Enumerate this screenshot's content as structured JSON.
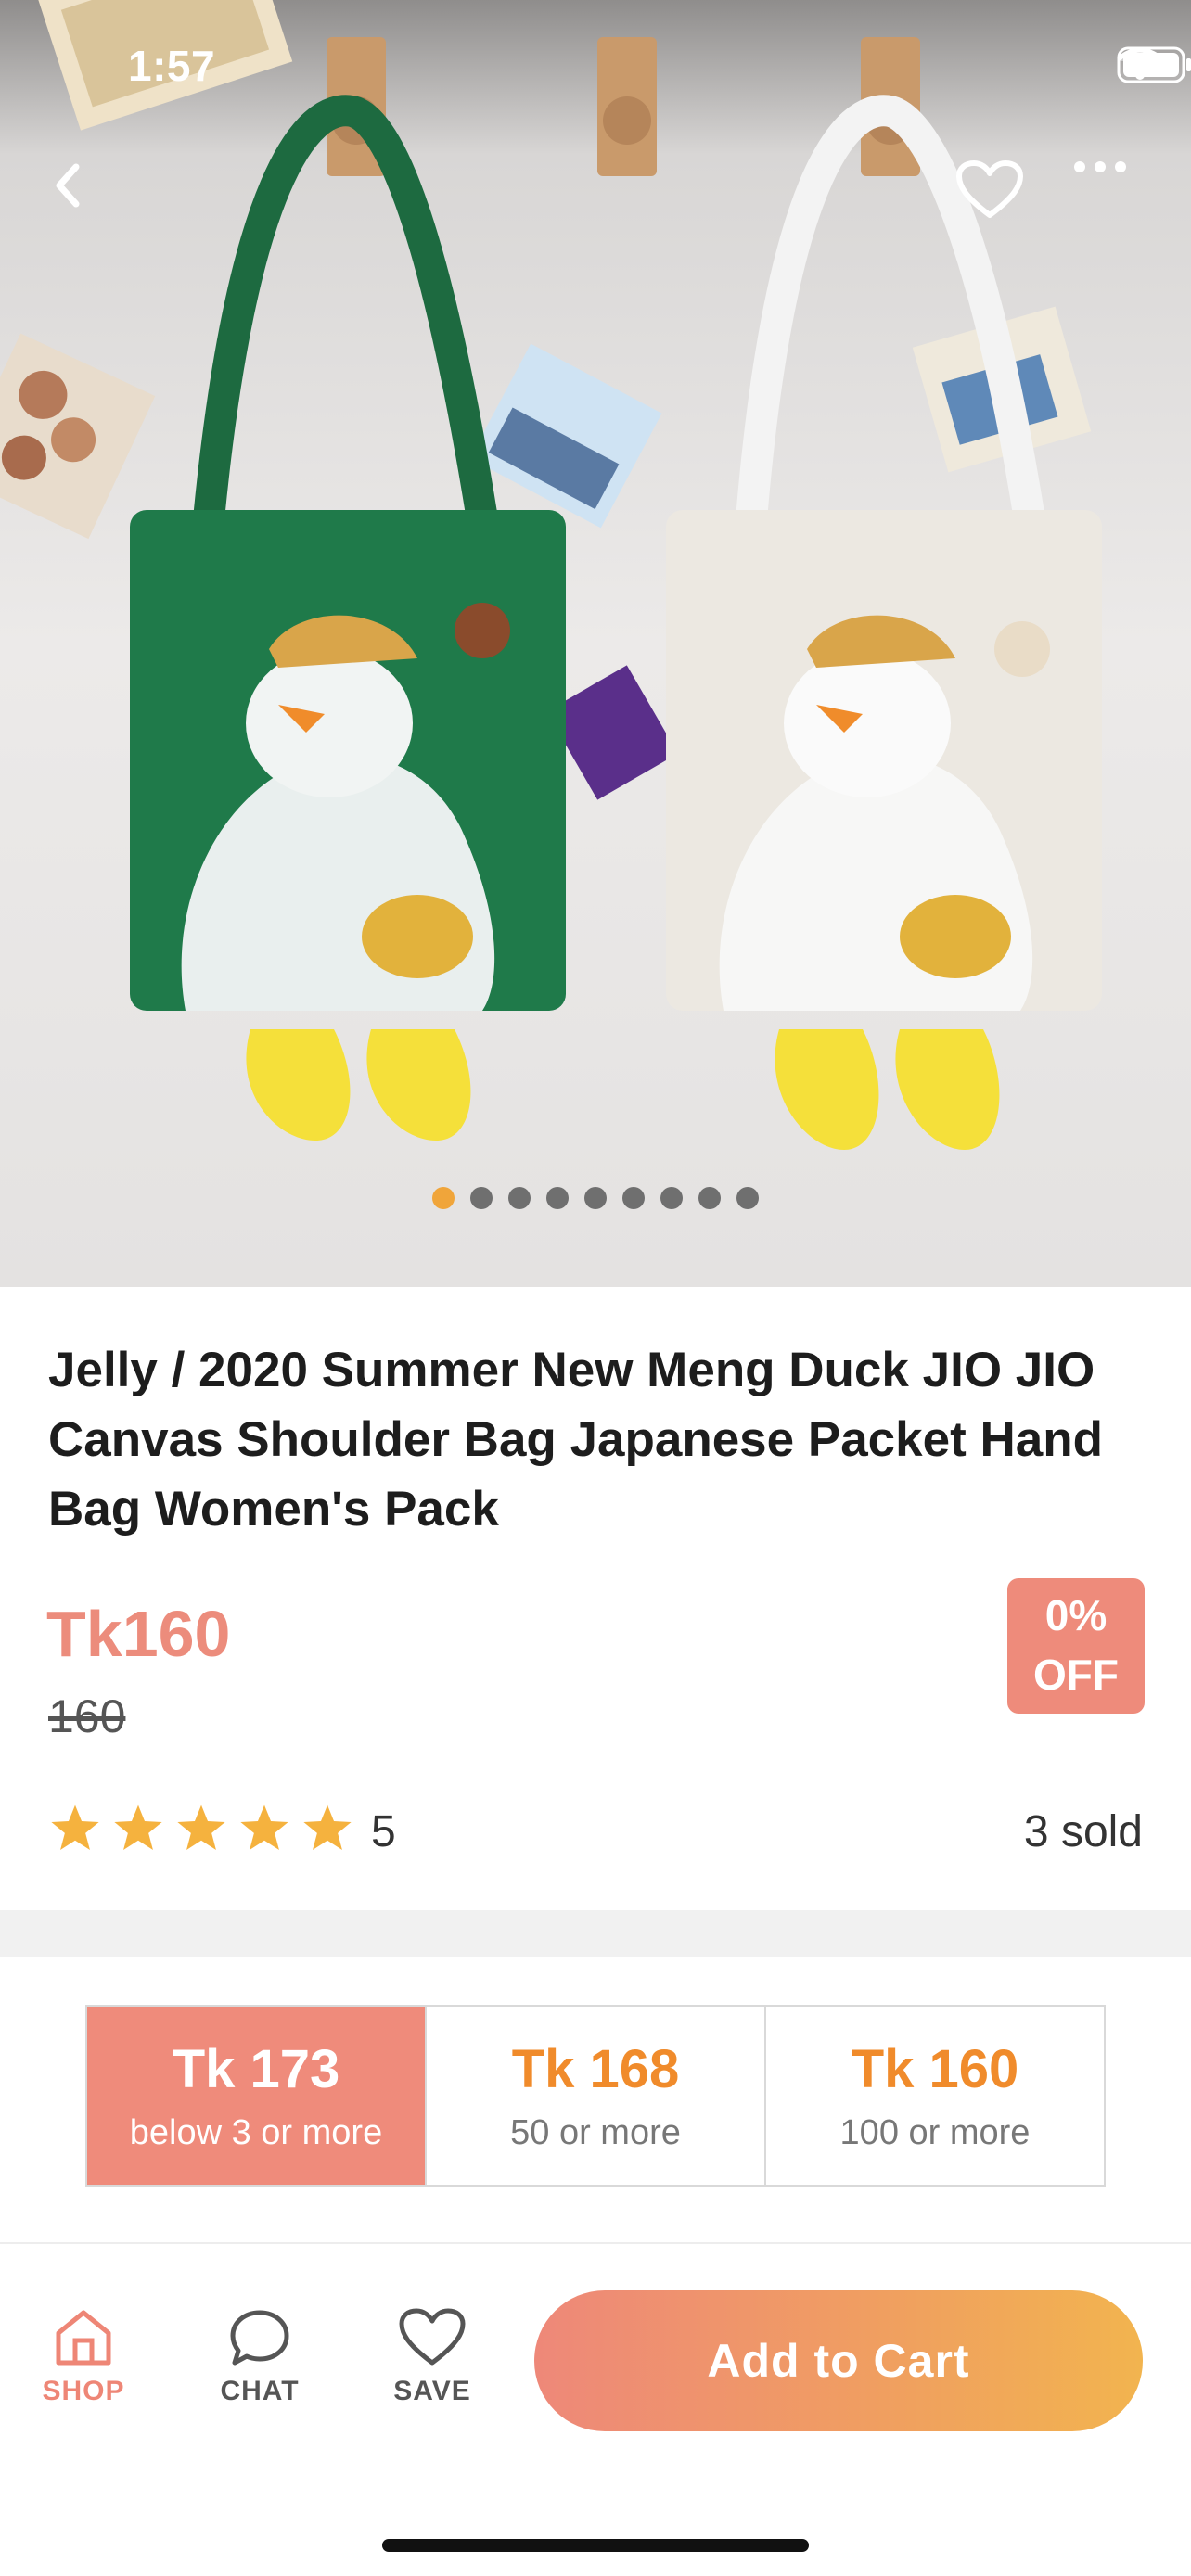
{
  "status_bar": {
    "time": "1:57"
  },
  "header": {
    "back_icon": "chevron-left-icon",
    "like_icon": "heart-icon",
    "more_icon": "more-horizontal-icon"
  },
  "gallery": {
    "image_count": 9,
    "active_index": 0
  },
  "product": {
    "title": "Jelly / 2020 Summer New Meng Duck JIO JIO Canvas Shoulder Bag Japanese Packet Hand Bag Women's Pack",
    "price": "Tk160",
    "original_price": "160",
    "discount_line1": "0%",
    "discount_line2": "OFF",
    "rating": 5,
    "rating_label": "5",
    "sold": "3 sold"
  },
  "tier_pricing": [
    {
      "price": "Tk 173",
      "quantity": "below 3 or more",
      "active": true
    },
    {
      "price": "Tk 168",
      "quantity": "50 or more",
      "active": false
    },
    {
      "price": "Tk 160",
      "quantity": "100 or more",
      "active": false
    }
  ],
  "bottom_bar": {
    "shop_label": "SHOP",
    "chat_label": "CHAT",
    "save_label": "SAVE",
    "cart_label": "Add to Cart"
  },
  "colors": {
    "accent": "#EE8B7B",
    "tier_price": "#F08B2B",
    "star": "#F5B23E",
    "active_dot": "#F0A53A"
  }
}
